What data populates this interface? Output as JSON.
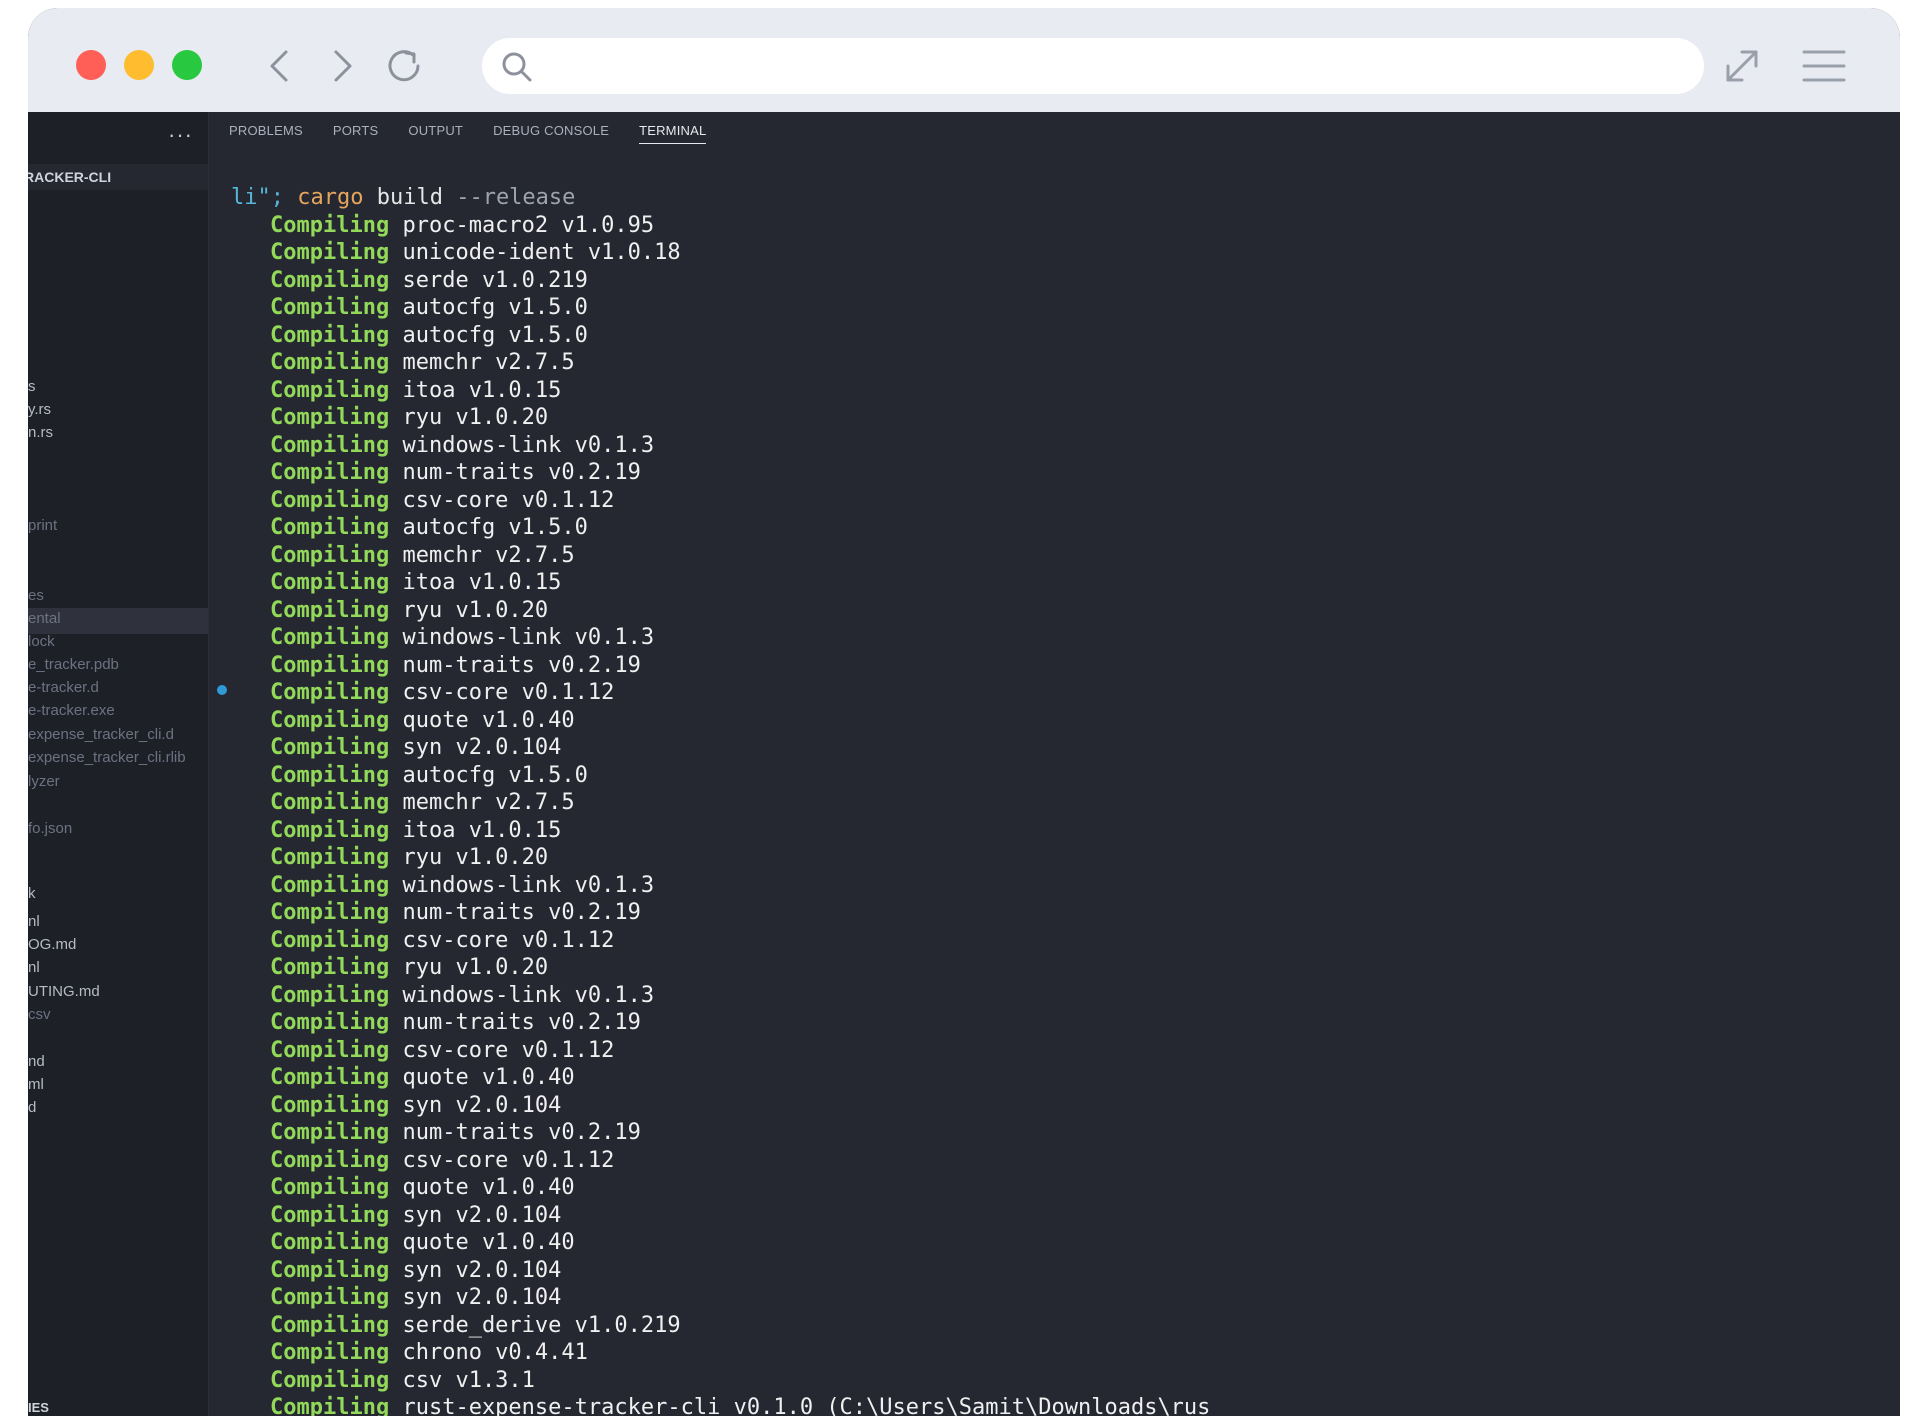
{
  "browser": {
    "address_placeholder": "",
    "icons": [
      "back-arrow-icon",
      "forward-arrow-icon",
      "reload-icon",
      "search-icon",
      "expand-icon",
      "hamburger-menu-icon"
    ]
  },
  "sidebar": {
    "more": "···",
    "folder_title": "RACKER-CLI",
    "items": [
      {
        "label": "s",
        "dim": false
      },
      {
        "label": "y.rs",
        "dim": false
      },
      {
        "label": "n.rs",
        "dim": false
      },
      {
        "label": "print",
        "dim": true
      },
      {
        "label": "es",
        "dim": true
      },
      {
        "label": "ental",
        "dim": true
      },
      {
        "label": "lock",
        "dim": true
      },
      {
        "label": "e_tracker.pdb",
        "dim": true
      },
      {
        "label": "e-tracker.d",
        "dim": true
      },
      {
        "label": "e-tracker.exe",
        "dim": true
      },
      {
        "label": "expense_tracker_cli.d",
        "dim": true
      },
      {
        "label": "expense_tracker_cli.rlib",
        "dim": true
      },
      {
        "label": "lyzer",
        "dim": true
      },
      {
        "label": "fo.json",
        "dim": true
      },
      {
        "label": "k",
        "dim": false
      },
      {
        "label": "nl",
        "dim": false
      },
      {
        "label": "OG.md",
        "dim": false
      },
      {
        "label": "nl",
        "dim": false
      },
      {
        "label": "UTING.md",
        "dim": false
      },
      {
        "label": "csv",
        "dim": true
      },
      {
        "label": "nd",
        "dim": false
      },
      {
        "label": "ml",
        "dim": false
      },
      {
        "label": "d",
        "dim": false
      }
    ],
    "footer": "IES"
  },
  "panel": {
    "tabs": [
      "PROBLEMS",
      "PORTS",
      "OUTPUT",
      "DEBUG CONSOLE",
      "TERMINAL"
    ],
    "active_tab": "TERMINAL"
  },
  "terminal": {
    "command": {
      "prefix": "li\";",
      "program": "cargo",
      "subcommand": "build",
      "flag": "--release"
    },
    "verb": "Compiling",
    "lines": [
      "proc-macro2 v1.0.95",
      "unicode-ident v1.0.18",
      "serde v1.0.219",
      "autocfg v1.5.0",
      "autocfg v1.5.0",
      "memchr v2.7.5",
      "itoa v1.0.15",
      "ryu v1.0.20",
      "windows-link v0.1.3",
      "num-traits v0.2.19",
      "csv-core v0.1.12",
      "autocfg v1.5.0",
      "memchr v2.7.5",
      "itoa v1.0.15",
      "ryu v1.0.20",
      "windows-link v0.1.3",
      "num-traits v0.2.19",
      "csv-core v0.1.12",
      "quote v1.0.40",
      "syn v2.0.104",
      "autocfg v1.5.0",
      "memchr v2.7.5",
      "itoa v1.0.15",
      "ryu v1.0.20",
      "windows-link v0.1.3",
      "num-traits v0.2.19",
      "csv-core v0.1.12",
      "ryu v1.0.20",
      "windows-link v0.1.3",
      "num-traits v0.2.19",
      "csv-core v0.1.12",
      "quote v1.0.40",
      "syn v2.0.104",
      "num-traits v0.2.19",
      "csv-core v0.1.12",
      "quote v1.0.40",
      "syn v2.0.104",
      "quote v1.0.40",
      "syn v2.0.104",
      "syn v2.0.104",
      "serde_derive v1.0.219",
      "chrono v0.4.41",
      "csv v1.3.1",
      "rust-expense-tracker-cli v0.1.0 (C:\\Users\\Samit\\Downloads\\rus"
    ]
  },
  "colors": {
    "terminal_bg": "#252731",
    "sidebar_bg": "#1e2028",
    "verb_green": "#92d959",
    "command_cyan": "#56b6d8",
    "command_orange": "#e5a55c",
    "marker_blue": "#2f9ad6"
  }
}
